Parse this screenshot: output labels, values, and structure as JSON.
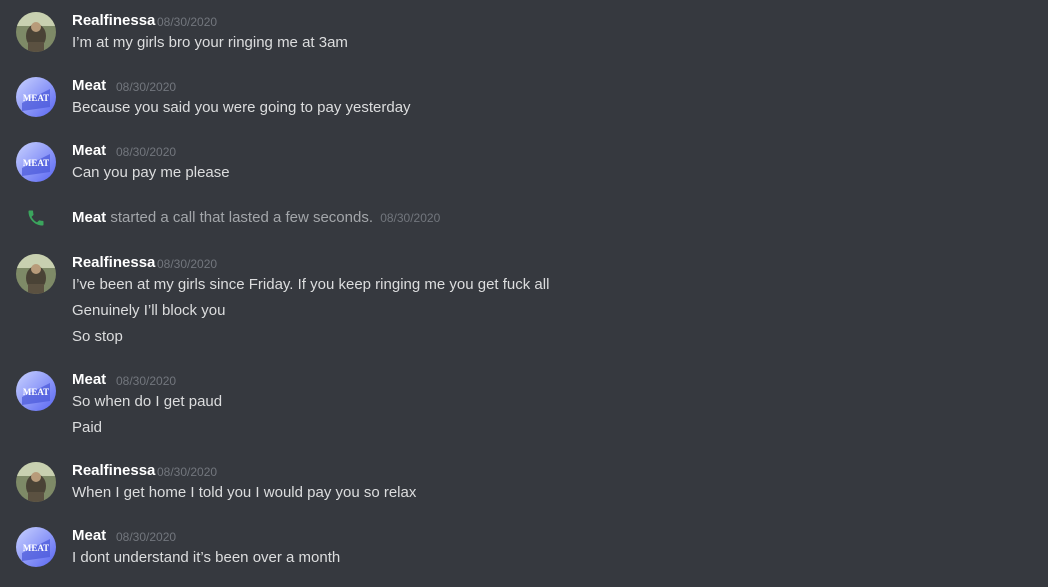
{
  "messages": [
    {
      "author": "Realfinessa",
      "timestamp": "08/30/2020",
      "lines": [
        "I’m at my girls bro your ringing me at 3am"
      ]
    },
    {
      "author": "Meat",
      "timestamp": "08/30/2020",
      "lines": [
        "Because you said you were going to pay yesterday"
      ]
    },
    {
      "author": "Meat",
      "timestamp": "08/30/2020",
      "lines": [
        "Can you pay me please"
      ]
    },
    {
      "author": "Realfinessa",
      "timestamp": "08/30/2020",
      "lines": [
        "I’ve been at my girls since Friday. If you keep ringing me you get fuck all",
        "Genuinely I’ll block you",
        "So stop"
      ]
    },
    {
      "author": "Meat",
      "timestamp": "08/30/2020",
      "lines": [
        "So when do I get paud",
        "Paid"
      ]
    },
    {
      "author": "Realfinessa",
      "timestamp": "08/30/2020",
      "lines": [
        "When I get home I told you I would pay you so relax"
      ]
    },
    {
      "author": "Meat",
      "timestamp": "08/30/2020",
      "lines": [
        "I dont understand it’s been over a month"
      ]
    }
  ],
  "call_event": {
    "author": "Meat",
    "text": "started a call that lasted a few seconds.",
    "timestamp": "08/30/2020",
    "icon": "phone-icon",
    "icon_color": "#3ba55d"
  },
  "avatars": {
    "meat_text": "MEAT",
    "meat_colors": [
      "#5865f2",
      "#a7b3f6"
    ],
    "realfinessa_colors": [
      "#6b7a52",
      "#c9c1a6"
    ]
  },
  "colors": {
    "background": "#36393f",
    "username": "#ffffff",
    "message": "#dcddde",
    "timestamp": "#72767d"
  }
}
